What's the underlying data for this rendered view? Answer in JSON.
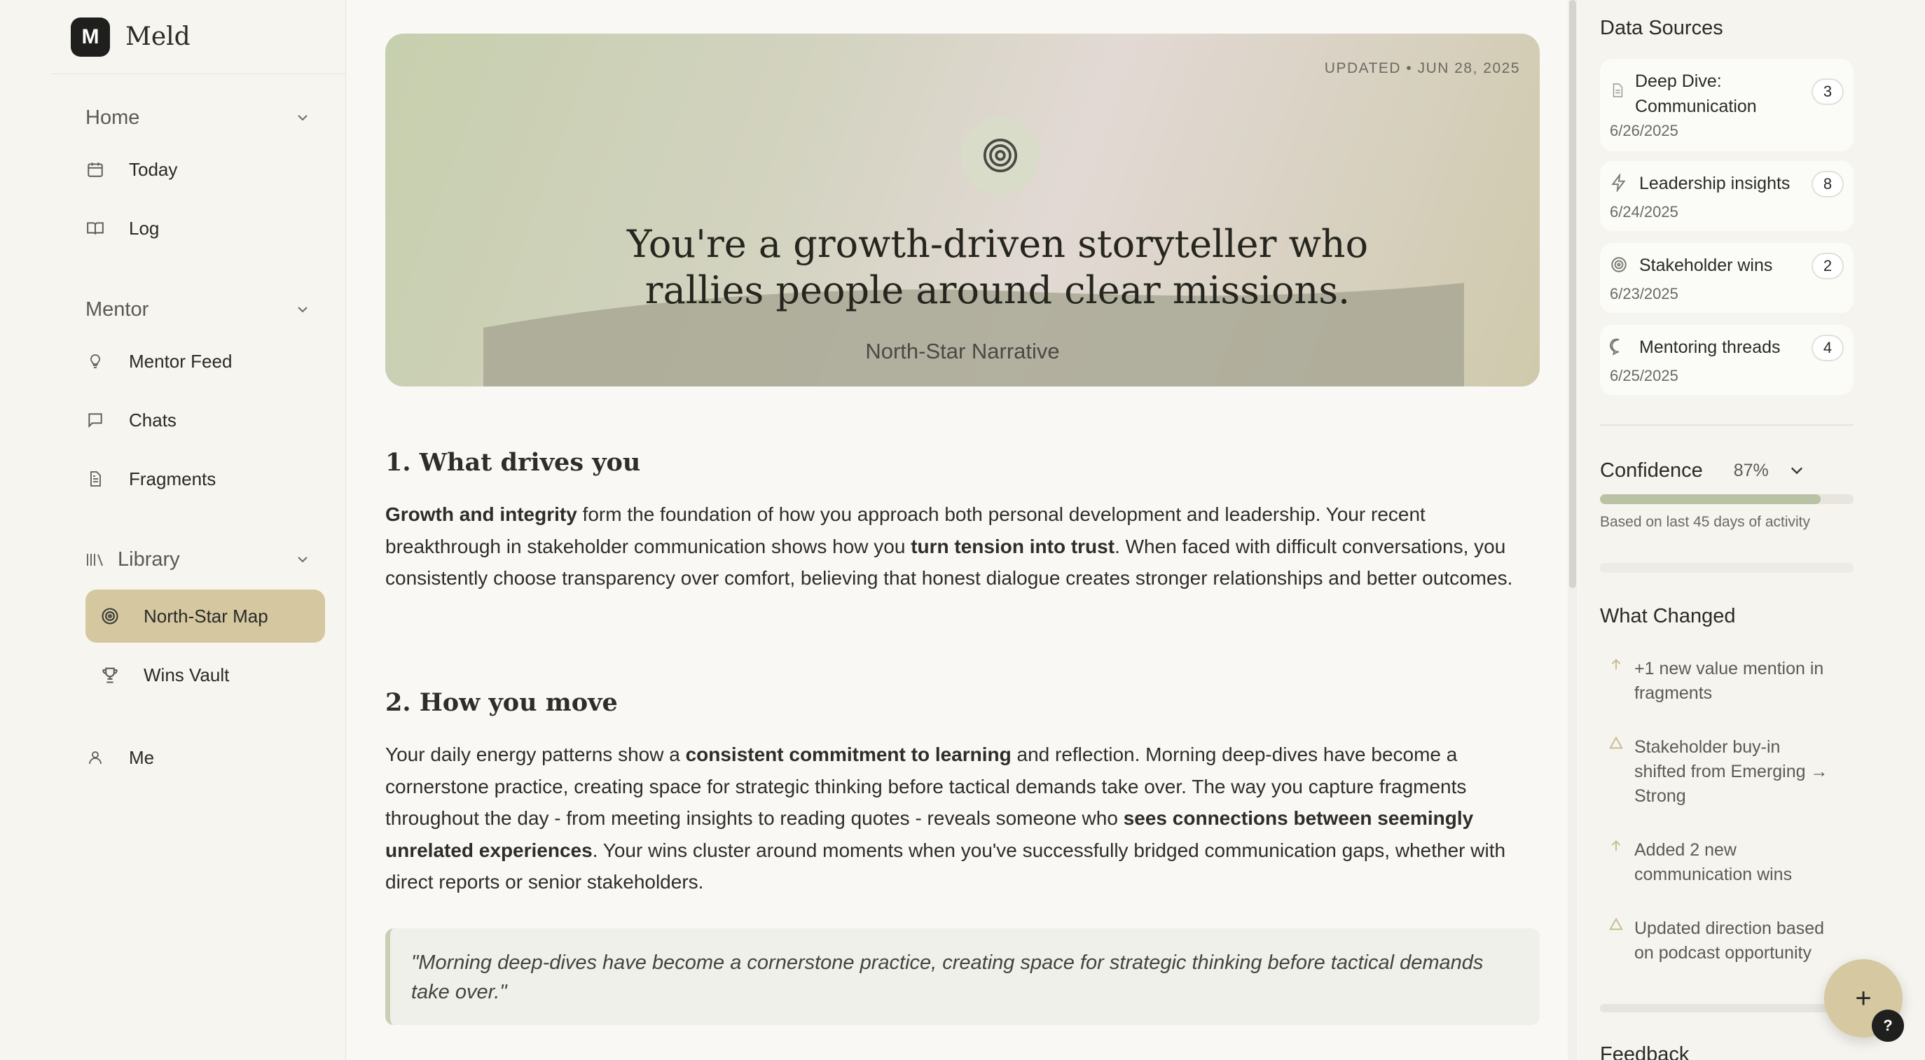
{
  "app": {
    "logo_letter": "M",
    "name": "Meld"
  },
  "sidebar": {
    "sections": {
      "home": {
        "label": "Home",
        "items": [
          {
            "label": "Today",
            "icon": "calendar-icon"
          },
          {
            "label": "Log",
            "icon": "book-icon"
          }
        ]
      },
      "mentor": {
        "label": "Mentor",
        "items": [
          {
            "label": "Mentor Feed",
            "icon": "lightbulb-icon"
          },
          {
            "label": "Chats",
            "icon": "chat-bubble-icon"
          },
          {
            "label": "Fragments",
            "icon": "document-icon"
          }
        ]
      },
      "library": {
        "label": "Library",
        "items": [
          {
            "label": "North-Star Map",
            "icon": "target-icon",
            "active": true
          },
          {
            "label": "Wins Vault",
            "icon": "trophy-icon"
          }
        ]
      }
    },
    "me": {
      "label": "Me",
      "icon": "user-icon"
    }
  },
  "hero": {
    "updated": "UPDATED • JUN 28, 2025",
    "title_line1": "You're a growth-driven storyteller who",
    "title_line2": "rallies people around clear missions.",
    "subtitle": "North-Star Narrative",
    "icon": "target-icon"
  },
  "content": {
    "s1": {
      "heading": "1. What drives you",
      "b1": "Growth and integrity",
      "t1": " form the foundation of how you approach both personal development and leadership. Your recent breakthrough in stakeholder communication shows how you ",
      "b2": "turn tension into trust",
      "t2": ". When faced with difficult conversations, you consistently choose transparency over comfort, believing that honest dialogue creates stronger relationships and better outcomes."
    },
    "s2": {
      "heading": "2. How you move",
      "t1": "Your daily energy patterns show a ",
      "b1": "consistent commitment to learning",
      "t2": " and reflection. Morning deep-dives have become a cornerstone practice, creating space for strategic thinking before tactical demands take over. The way you capture fragments throughout the day - from meeting insights to reading quotes - reveals someone who ",
      "b2": "sees connections between seemingly unrelated experiences",
      "t3": ". Your wins cluster around moments when you've successfully bridged communication gaps, whether with direct reports or senior stakeholders."
    },
    "quote": "\"Morning deep-dives have become a cornerstone practice, creating space for strategic thinking before tactical demands take over.\""
  },
  "right": {
    "data_sources_title": "Data Sources",
    "sources": [
      {
        "line1": "Deep Dive:",
        "line2": "Communication",
        "date": "6/26/2025",
        "count": "3",
        "icon": "document-icon"
      },
      {
        "line1": "Leadership insights",
        "date": "6/24/2025",
        "count": "8",
        "icon": "lightning-icon"
      },
      {
        "line1": "Stakeholder wins",
        "date": "6/23/2025",
        "count": "2",
        "icon": "target-icon"
      },
      {
        "line1": "Mentoring threads",
        "date": "6/25/2025",
        "count": "4",
        "icon": "chat-bubble-icon"
      }
    ],
    "confidence": {
      "label": "Confidence",
      "value": "87%",
      "fraction": 0.87,
      "note": "Based on last 45 days of activity"
    },
    "what_changed_title": "What Changed",
    "changes": [
      {
        "line1": "+1 new value mention in",
        "line2": "fragments",
        "icon": "arrow-up-icon"
      },
      {
        "line1": "Stakeholder buy-in",
        "line2": "shifted from Emerging →",
        "line3": "Strong",
        "icon": "triangle-icon"
      },
      {
        "line1": "Added 2 new",
        "line2": "communication wins",
        "icon": "arrow-up-icon"
      },
      {
        "line1": "Updated direction based",
        "line2": "on podcast opportunity",
        "icon": "triangle-icon"
      }
    ],
    "feedback_title": "Feedback"
  },
  "fab": {
    "label": "+"
  },
  "help": {
    "label": "?"
  },
  "colors": {
    "accent": "#d5c8a1",
    "confidence_fill": "#b9c2a2",
    "change_icon": "#c7b98d"
  }
}
